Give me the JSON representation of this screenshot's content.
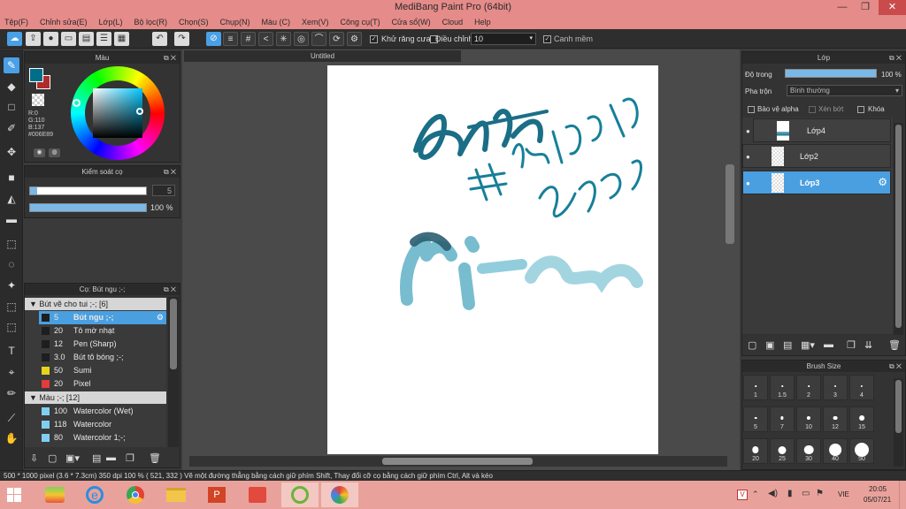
{
  "window": {
    "title": "MediBang Paint Pro (64bit)",
    "minimize": "—",
    "maximize": "❐",
    "close": "✕"
  },
  "menu": [
    "Tệp(F)",
    "Chỉnh sửa(E)",
    "Lớp(L)",
    "Bộ lọc(R)",
    "Chọn(S)",
    "Chụp(N)",
    "Màu (C)",
    "Xem(V)",
    "Công cụ(T)",
    "Cửa sổ(W)",
    "Cloud",
    "Help"
  ],
  "toolbar": {
    "antialias_label": "Khử răng cưa",
    "adjust_label": "Điều chỉnh",
    "adjust_value": "10",
    "soft_edge_label": "Canh mềm"
  },
  "color_panel": {
    "title": "Màu",
    "r": "R:0",
    "g": "G:110",
    "b": "B:137",
    "hex": "#006E89",
    "current_color": "#006E89"
  },
  "brush_control": {
    "title": "Kiểm soát cọ",
    "size_value": "5",
    "opacity_value": "100 %"
  },
  "brush_panel": {
    "title": "Cọ: Bút ngu ;-;",
    "group1": "Bút vẽ cho tui ;-; [6]",
    "group1_items": [
      {
        "size": "5",
        "name": "Bút ngu ;-;",
        "color": "#1e1e1e"
      },
      {
        "size": "20",
        "name": "Tô mờ nhạt",
        "color": "#1e1e1e"
      },
      {
        "size": "12",
        "name": "Pen (Sharp)",
        "color": "#1e1e1e"
      },
      {
        "size": "3.0",
        "name": "Bút tô bóng ;-;",
        "color": "#1e1e1e"
      },
      {
        "size": "50",
        "name": "Sumi",
        "color": "#e8d21a"
      },
      {
        "size": "20",
        "name": "Pixel",
        "color": "#e43b3b"
      }
    ],
    "group2": "Màu ;-; [12]",
    "group2_items": [
      {
        "size": "100",
        "name": "Watercolor (Wet)",
        "color": "#7fd0f0"
      },
      {
        "size": "118",
        "name": "Watercolor",
        "color": "#7fd0f0"
      },
      {
        "size": "80",
        "name": "Watercolor 1;-;",
        "color": "#7fd0f0"
      }
    ]
  },
  "canvas": {
    "tab_title": "Untitled"
  },
  "layer_panel": {
    "title": "Lớp",
    "opacity_label": "Độ trong",
    "opacity_value": "100 %",
    "blend_label": "Pha trộn",
    "blend_value": "Bình thường",
    "protect_alpha": "Bảo vệ alpha",
    "clipping": "Xén bớt",
    "lock": "Khóa",
    "layers": [
      "Lớp4",
      "Lớp2",
      "Lớp3"
    ]
  },
  "brush_size_panel": {
    "title": "Brush Size",
    "sizes": [
      "1",
      "1.5",
      "2",
      "3",
      "4",
      "5",
      "7",
      "10",
      "12",
      "15",
      "20",
      "25",
      "30",
      "40",
      "50"
    ]
  },
  "status": {
    "text": "500 * 1000 pixel   (3.6 * 7.3cm)   350 dpi   100 %   ( 521, 332 )   Vẽ một đường thẳng bằng cách giữ phím Shift, Thay đổi cỡ cọ bằng cách giữ phím Ctrl, Alt và kéo"
  },
  "taskbar": {
    "lang": "VIE",
    "time": "20:05",
    "date": "05/07/21"
  }
}
